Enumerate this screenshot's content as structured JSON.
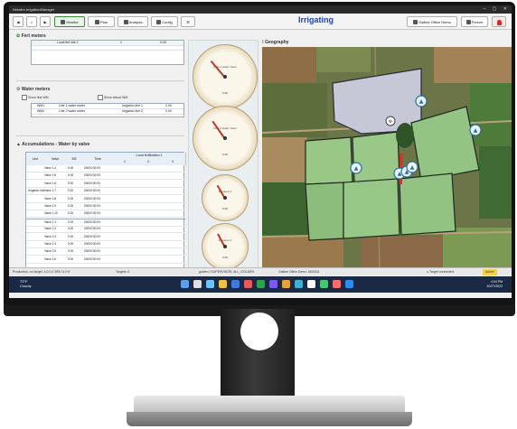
{
  "window": {
    "title": "Netafim IrrigationManager",
    "controls": "– ▢ ✕"
  },
  "toolbar": {
    "back": "◀",
    "home": "⌂",
    "forward": "▶",
    "monitor_label": "Monitor",
    "plan_label": "Plan",
    "analysis_label": "Analysis",
    "config_label": "Config",
    "tools_label": "⚒",
    "state_text": "Irrigating",
    "office_label": "Galilee Office Demo",
    "freeze_label": "Freeze",
    "alert_icon": "alarm-icon"
  },
  "fert_meters": {
    "title": "Fert meters",
    "rows": [
      {
        "name": "Local fert site 1",
        "a": "1",
        "b": "0.00"
      }
    ]
  },
  "water_meters": {
    "title": "Water meters",
    "show_first": "Show first WM",
    "show_virtual": "Show virtual WM",
    "rows": [
      {
        "id": "WM1",
        "name": "Line 1 water meter",
        "line": "Irrigation line 1",
        "val": "0.00"
      },
      {
        "id": "WM2",
        "name": "Line 2 water meter",
        "line": "Irrigation line 2",
        "val": "0.00"
      }
    ]
  },
  "accumulations": {
    "title": "Accumulations - Water by valve",
    "headers": {
      "line": "Line",
      "valve": "Valve",
      "m3": "M3",
      "time": "Time",
      "local_fert": "Local fertilization 1",
      "c1": "1",
      "c2": "2",
      "c3": "3"
    },
    "line_label": "Irrigation line",
    "rows": [
      {
        "valve": "Valve 1.4",
        "m3": "0.00",
        "time": "00000:00:00"
      },
      {
        "valve": "Valve 1.5",
        "m3": "0.00",
        "time": "00000:00:00"
      },
      {
        "valve": "Valve 1.6",
        "m3": "0.00",
        "time": "00000:00:00"
      },
      {
        "valve": "Valve 1.7",
        "m3": "0.00",
        "time": "00000:00:00"
      },
      {
        "valve": "Valve 1.8",
        "m3": "0.00",
        "time": "00000:00:00"
      },
      {
        "valve": "Valve 1.9",
        "m3": "0.00",
        "time": "00000:00:00"
      },
      {
        "valve": "Valve 1.10",
        "m3": "0.00",
        "time": "00000:00:00"
      },
      {
        "valve": "Valve 2.1",
        "m3": "0.00",
        "time": "00000:00:00"
      },
      {
        "valve": "Valve 2.2",
        "m3": "0.00",
        "time": "00000:00:00"
      },
      {
        "valve": "Valve 2.3",
        "m3": "0.00",
        "time": "00000:00:00"
      },
      {
        "valve": "Valve 2.4",
        "m3": "0.00",
        "time": "00000:00:00"
      },
      {
        "valve": "Valve 2.5",
        "m3": "0.00",
        "time": "00000:00:00"
      },
      {
        "valve": "Valve 2.6",
        "m3": "0.00",
        "time": "00000:00:00"
      }
    ]
  },
  "gauges": [
    {
      "label": "Flow 1 water meter",
      "value": "0.00"
    },
    {
      "label": "Flow 2 water meter",
      "value": "0.00"
    },
    {
      "label": "Pressure 1",
      "value": "0.00"
    },
    {
      "label": "Pressure 2",
      "value": "0.00"
    }
  ],
  "geography": {
    "title": "Geography"
  },
  "status": {
    "left": "Production, on-target, 4.0.0.0 JRE 11.0.9",
    "targets": "Targets: 0",
    "user": "golden / SUPERVISOR, ALL_GOLDEN",
    "office": "Galilee Office Demo 1600011",
    "target_connected": "Target connected",
    "state": "Active"
  },
  "taskbar": {
    "temp": "73°F",
    "weather": "Cloudy",
    "time": "4:24 PM",
    "date": "10/27/2022"
  },
  "colors": {
    "accent": "#1e3fb4",
    "alarm": "#d62b2b",
    "field": "#8fbf7a",
    "field_border": "#1d2a1d"
  }
}
